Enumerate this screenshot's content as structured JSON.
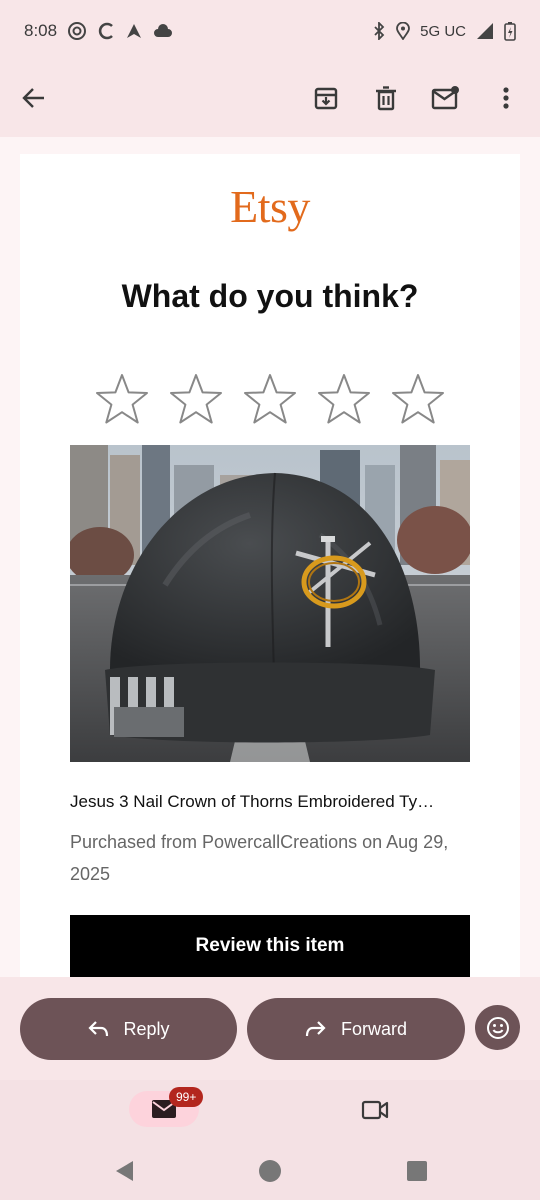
{
  "status_bar": {
    "time": "8:08",
    "network": "5G UC",
    "icons": [
      "at-sign-icon",
      "c-icon",
      "arrow-up-icon",
      "cloud-icon",
      "bluetooth-icon",
      "location-icon",
      "signal-icon",
      "battery-icon"
    ]
  },
  "app_bar": {
    "icons": [
      "back-arrow-icon",
      "archive-icon",
      "delete-icon",
      "mark-unread-icon",
      "more-vert-icon"
    ]
  },
  "email": {
    "logo_text": "Etsy",
    "headline": "What do you think?",
    "rating": {
      "stars_total": 5,
      "stars_selected": 0
    },
    "product_title": "Jesus 3 Nail Crown of Thorns Embroidered Ty…",
    "purchase_info": "Purchased from PowercallCreations on Aug 29, 2025",
    "review_button": "Review this item"
  },
  "reply_bar": {
    "reply_label": "Reply",
    "forward_label": "Forward",
    "emoji_icon": "emoji-icon"
  },
  "bottom_nav": {
    "mail_badge": "99+",
    "icons": [
      "mail-icon",
      "video-camera-icon"
    ]
  },
  "colors": {
    "etsy_orange": "#e26a1c",
    "pill_bg": "#6d5357",
    "badge_red": "#b3261e",
    "surface": "#f8e6e8"
  }
}
